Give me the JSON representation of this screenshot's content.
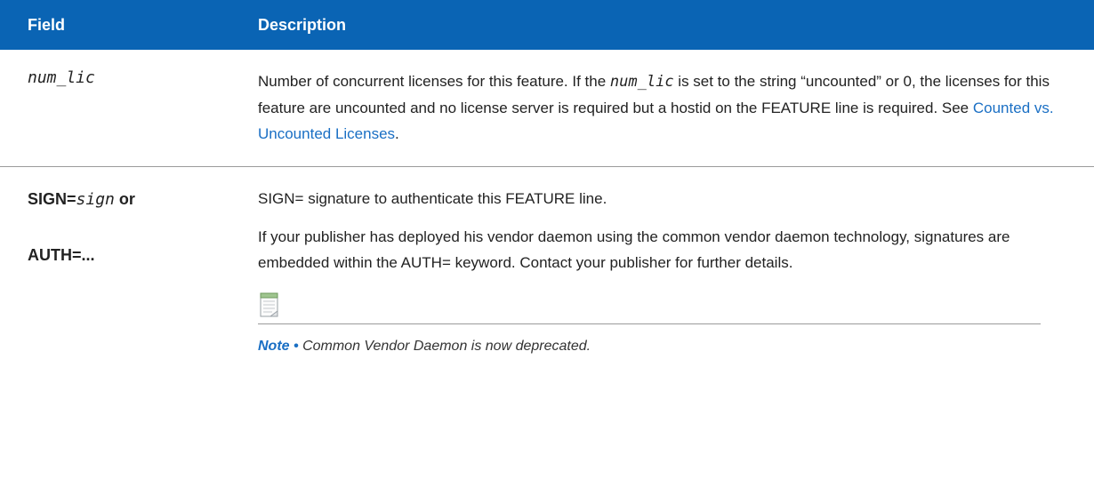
{
  "table": {
    "headers": {
      "field": "Field",
      "description": "Description"
    },
    "row1": {
      "field": "num_lic",
      "desc_part1": "Number of concurrent licenses for this feature. If the ",
      "desc_code": "num_lic",
      "desc_part2": " is set to the string “uncounted” or 0, the licenses for this feature are uncounted and no license server is required but a hostid on the FEATURE line is required. See ",
      "desc_link": "Counted vs. Uncounted Licenses",
      "desc_part3": "."
    },
    "row2": {
      "field_sign_prefix": "SIGN=",
      "field_sign_var": "sign",
      "field_or": " or",
      "field_auth": "AUTH=...",
      "desc_p1": "SIGN= signature to authenticate this FEATURE line.",
      "desc_p2": "If your publisher has deployed his vendor daemon using the common vendor daemon technology, signatures are embedded within the AUTH= keyword. Contact your publisher for further details.",
      "note_icon": "notepad-icon",
      "note_label": "Note",
      "note_bullet": " • ",
      "note_text": "Common Vendor Daemon is now deprecated."
    }
  }
}
